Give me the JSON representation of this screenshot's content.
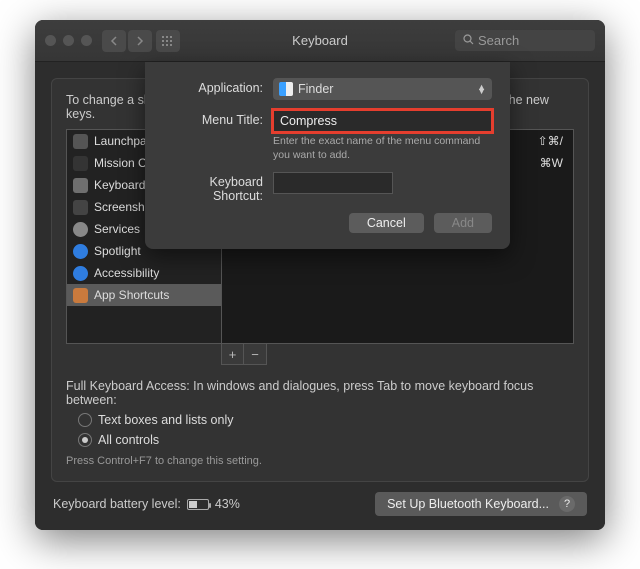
{
  "window": {
    "title": "Keyboard",
    "search_placeholder": "Search"
  },
  "panel": {
    "description": "To change a shortcut, select it, double-click the key combination, and then type the new keys."
  },
  "sidebar": {
    "items": [
      {
        "label": "Launchpad & Dock",
        "color": "#555"
      },
      {
        "label": "Mission Control",
        "color": "#343434"
      },
      {
        "label": "Keyboard",
        "color": "#6f6f6f"
      },
      {
        "label": "Screenshots",
        "color": "#444"
      },
      {
        "label": "Services",
        "color": "#888"
      },
      {
        "label": "Spotlight",
        "color": "#2f7de0"
      },
      {
        "label": "Accessibility",
        "color": "#2f7de0"
      },
      {
        "label": "App Shortcuts",
        "color": "#c97a3d"
      }
    ],
    "selected": 7
  },
  "rightpane": {
    "rows": [
      {
        "shortcut": "⇧⌘/"
      },
      {
        "shortcut": "⌘W"
      }
    ]
  },
  "fka": {
    "text": "Full Keyboard Access: In windows and dialogues, press Tab to move keyboard focus between:",
    "option1": "Text boxes and lists only",
    "option2": "All controls",
    "hint": "Press Control+F7 to change this setting."
  },
  "footer": {
    "battery_label": "Keyboard battery level:",
    "battery_pct": "43%",
    "bluetooth_btn": "Set Up Bluetooth Keyboard..."
  },
  "sheet": {
    "labels": {
      "application": "Application:",
      "menu_title": "Menu Title:",
      "shortcut": "Keyboard Shortcut:"
    },
    "application_value": "Finder",
    "menu_title_value": "Compress",
    "menu_title_help": "Enter the exact name of the menu command you want to add.",
    "cancel": "Cancel",
    "add": "Add"
  }
}
